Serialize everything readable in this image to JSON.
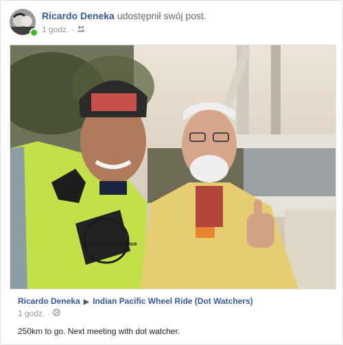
{
  "post": {
    "author": "Ricardo Deneka",
    "action": "udostępnił swój post.",
    "time": "1 godz.",
    "separator": "·",
    "audience_icon": "friends-icon"
  },
  "shared": {
    "author": "Ricardo Deneka",
    "arrow": "▶",
    "target": "Indian Pacific Wheel Ride (Dot Watchers)",
    "time": "1 godz.",
    "separator": "·",
    "audience_icon": "globe-icon",
    "text": "250km to go. Next meeting with dot watcher."
  },
  "photo": {
    "jersey_print": "TRANS AM BIKE RACE",
    "badge": "Trans Am Bike Race"
  },
  "colors": {
    "link": "#365899",
    "meta": "#90949c",
    "online": "#42b72a"
  }
}
